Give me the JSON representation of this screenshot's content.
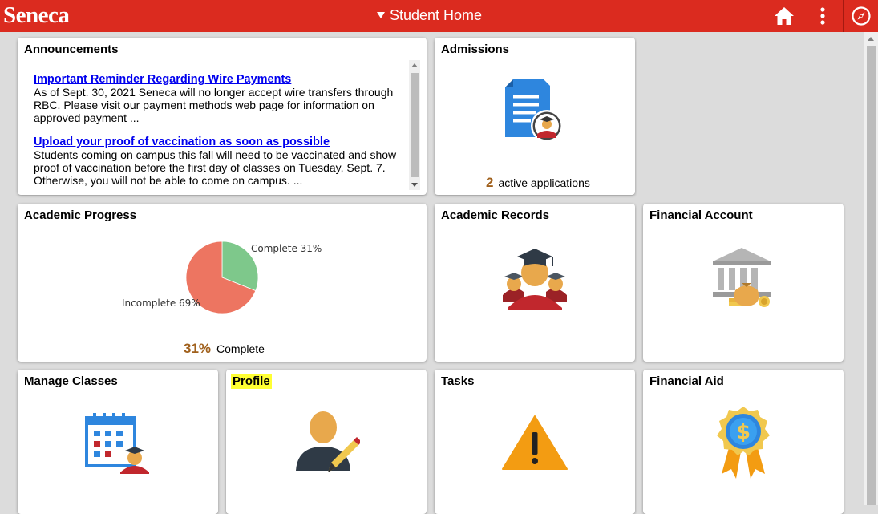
{
  "header": {
    "logo": "Seneca",
    "title": "Student Home",
    "colors": {
      "bar": "#db2b1f",
      "accent_value": "#a0601c"
    },
    "icons": [
      "home-icon",
      "more-vertical-icon",
      "navbar-compass-icon"
    ]
  },
  "tiles": {
    "announcements": {
      "title": "Announcements",
      "items": [
        {
          "link": "Important Reminder Regarding Wire Payments",
          "text": "As of Sept. 30, 2021 Seneca will no longer accept wire transfers through RBC. Please visit our payment methods web page for information on approved payment ..."
        },
        {
          "link": "Upload your proof of vaccination as soon as possible",
          "text": "Students coming on campus this fall will need to be vaccinated and show proof of vaccination before the first day of classes on Tuesday, Sept. 7. Otherwise, you will not be able to come on campus. ..."
        }
      ]
    },
    "admissions": {
      "title": "Admissions",
      "count": "2",
      "count_label": "active applications",
      "icon": "application-document-icon"
    },
    "academic_progress": {
      "title": "Academic Progress",
      "percent": "31%",
      "percent_label": "Complete",
      "chart_data": {
        "type": "pie",
        "slices": [
          {
            "label": "Complete 31%",
            "value": 31,
            "color": "#7ec88b"
          },
          {
            "label": "Incomplete 69%",
            "value": 69,
            "color": "#ed7561"
          }
        ]
      }
    },
    "academic_records": {
      "title": "Academic Records",
      "icon": "graduates-icon"
    },
    "financial_account": {
      "title": "Financial Account",
      "icon": "bank-money-icon"
    },
    "manage_classes": {
      "title": "Manage Classes",
      "icon": "calendar-student-icon"
    },
    "profile": {
      "title": "Profile",
      "icon": "profile-edit-icon"
    },
    "tasks": {
      "title": "Tasks",
      "icon": "warning-icon"
    },
    "financial_aid": {
      "title": "Financial Aid",
      "icon": "dollar-award-icon"
    }
  }
}
